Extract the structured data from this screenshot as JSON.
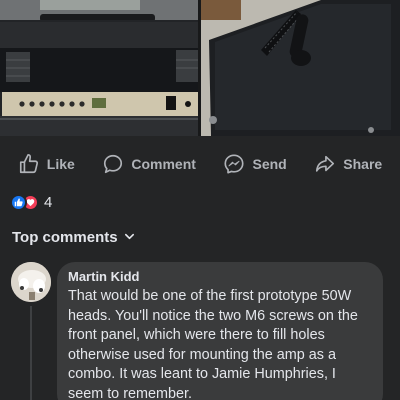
{
  "post": {
    "photos": [
      {
        "icon": "amp-head-front-photo"
      },
      {
        "icon": "amp-head-top-panel-photo"
      }
    ]
  },
  "actions": [
    {
      "label": "Like",
      "icon": "thumbs-up-icon"
    },
    {
      "label": "Comment",
      "icon": "comment-bubble-icon"
    },
    {
      "label": "Send",
      "icon": "messenger-icon"
    },
    {
      "label": "Share",
      "icon": "share-arrow-icon"
    }
  ],
  "reactions": {
    "count": "4",
    "types": [
      "like",
      "love"
    ],
    "colors": {
      "like": "#1877f2",
      "love": "#f33e58"
    }
  },
  "comments": {
    "header": "Top comments",
    "items": [
      {
        "author": "Martin Kidd",
        "text": "That would be one of the first prototype 50W heads. You'll notice the two M6 screws on the front panel, which were there to fill holes otherwise used for mounting the amp as a combo. It was leant to Jamie Humphries, I seem to remember."
      }
    ]
  },
  "theme": {
    "background": "#242526",
    "bubble": "#3a3b3c",
    "text_primary": "#e4e6eb",
    "text_secondary": "#b0b3b8"
  }
}
